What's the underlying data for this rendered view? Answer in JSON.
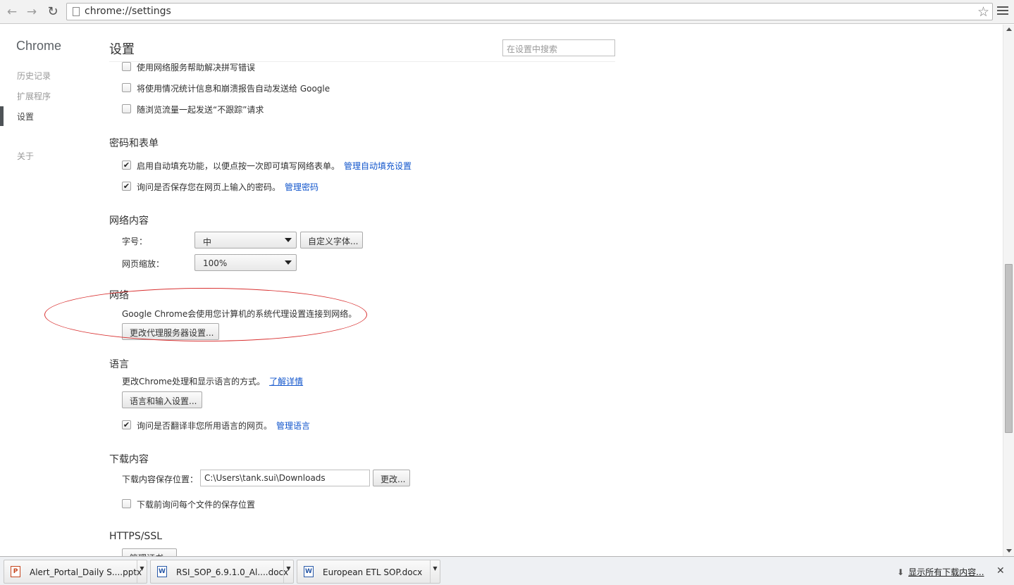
{
  "browser": {
    "url": "chrome://settings"
  },
  "sidebar": {
    "brand": "Chrome",
    "items": [
      {
        "label": "历史记录"
      },
      {
        "label": "扩展程序"
      },
      {
        "label": "设置"
      },
      {
        "label": "关于"
      }
    ]
  },
  "header": {
    "title": "设置",
    "search_placeholder": "在设置中搜索"
  },
  "privacy": {
    "checkboxes": [
      {
        "label": "使用网络服务帮助解决拼写错误",
        "checked": false
      },
      {
        "label": "将使用情况统计信息和崩溃报告自动发送给 Google",
        "checked": false
      },
      {
        "label": "随浏览流量一起发送“不跟踪”请求",
        "checked": false
      }
    ]
  },
  "passwords": {
    "title": "密码和表单",
    "autofill_label": "启用自动填充功能，以便点按一次即可填写网络表单。",
    "autofill_link": "管理自动填充设置",
    "save_pw_label": "询问是否保存您在网页上输入的密码。",
    "save_pw_link": "管理密码",
    "check_mark": "✔"
  },
  "web_content": {
    "title": "网络内容",
    "font_size_label": "字号：",
    "font_size_value": "中",
    "customize_fonts_button": "自定义字体...",
    "zoom_label": "网页缩放：",
    "zoom_value": "100%"
  },
  "network": {
    "title": "网络",
    "description": "Google Chrome会使用您计算机的系统代理设置连接到网络。",
    "proxy_button": "更改代理服务器设置..."
  },
  "language": {
    "title": "语言",
    "description": "更改Chrome处理和显示语言的方式。",
    "learn_more_link": "了解详情",
    "lang_button": "语言和输入设置...",
    "translate_label": "询问是否翻译非您所用语言的网页。",
    "translate_link": "管理语言",
    "check_mark": "✔"
  },
  "downloads": {
    "title": "下载内容",
    "location_label": "下载内容保存位置：",
    "location_value": "C:\\Users\\tank.sui\\Downloads",
    "change_button": "更改...",
    "ask_label": "下载前询问每个文件的保存位置"
  },
  "https": {
    "title": "HTTPS/SSL",
    "button_partial": "管理证书..."
  },
  "shelf": {
    "items": [
      {
        "name": "Alert_Portal_Daily S....pptx",
        "icon": "P"
      },
      {
        "name": "RSI_SOP_6.9.1.0_Al....docx",
        "icon": "W"
      },
      {
        "name": "European ETL SOP.docx",
        "icon": "W"
      }
    ],
    "show_all": "显示所有下载内容...",
    "close": "✕",
    "dropdown": "▼",
    "download_arrow": "⬇"
  },
  "icons": {
    "back": "←",
    "forward": "→",
    "reload": "↻",
    "star": "☆"
  },
  "colors": {
    "link": "#1155cc",
    "annotation_red": "#d93232"
  }
}
